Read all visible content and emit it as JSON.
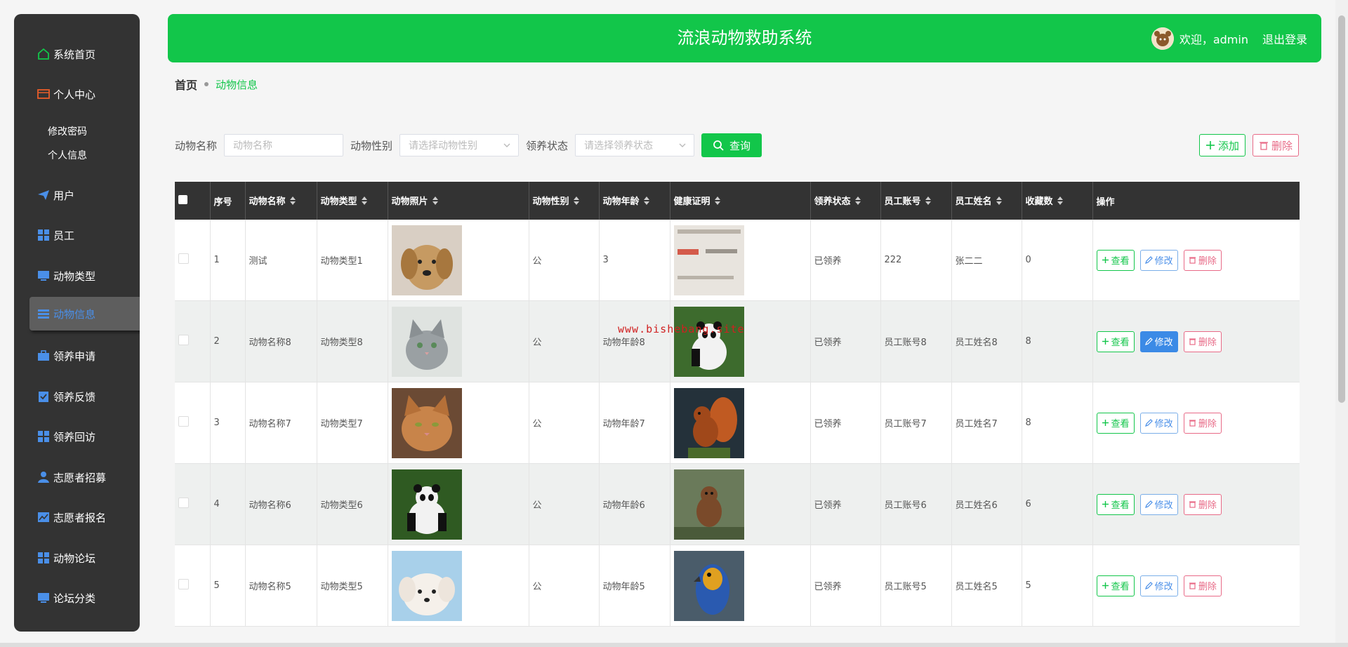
{
  "sidebar": {
    "items": [
      {
        "label": "系统首页",
        "icon": "home-icon",
        "color": "#12c64a"
      },
      {
        "label": "个人中心",
        "icon": "wallet-icon",
        "color": "#e85c2a"
      },
      {
        "label": "用户",
        "icon": "paper-plane-icon",
        "color": "#4a8fe8"
      },
      {
        "label": "员工",
        "icon": "grid-icon",
        "color": "#4a8fe8"
      },
      {
        "label": "动物类型",
        "icon": "monitor-icon",
        "color": "#4a8fe8"
      },
      {
        "label": "动物信息",
        "icon": "menu-icon",
        "color": "#4a8fe8"
      },
      {
        "label": "领养申请",
        "icon": "briefcase-icon",
        "color": "#4a8fe8"
      },
      {
        "label": "领养反馈",
        "icon": "clipboard-icon",
        "color": "#4a8fe8"
      },
      {
        "label": "领养回访",
        "icon": "grid-icon",
        "color": "#4a8fe8"
      },
      {
        "label": "志愿者招募",
        "icon": "user-icon",
        "color": "#4a8fe8"
      },
      {
        "label": "志愿者报名",
        "icon": "chart-icon",
        "color": "#4a8fe8"
      },
      {
        "label": "动物论坛",
        "icon": "grid-icon",
        "color": "#4a8fe8"
      },
      {
        "label": "论坛分类",
        "icon": "monitor-icon",
        "color": "#4a8fe8"
      }
    ],
    "sub_items": [
      "修改密码",
      "个人信息"
    ]
  },
  "header": {
    "title": "流浪动物救助系统",
    "welcome": "欢迎，admin",
    "logout": "退出登录"
  },
  "breadcrumb": {
    "home": "首页",
    "current": "动物信息"
  },
  "search": {
    "name_label": "动物名称",
    "name_placeholder": "动物名称",
    "gender_label": "动物性别",
    "gender_placeholder": "请选择动物性别",
    "status_label": "领养状态",
    "status_placeholder": "请选择领养状态",
    "search_button": "查询",
    "add_button": "添加",
    "delete_button": "删除"
  },
  "table": {
    "headers": [
      "序号",
      "动物名称",
      "动物类型",
      "动物照片",
      "动物性别",
      "动物年龄",
      "健康证明",
      "领养状态",
      "员工账号",
      "员工姓名",
      "收藏数",
      "操作"
    ],
    "rows": [
      {
        "no": "1",
        "name": "测试",
        "type": "动物类型1",
        "photo": "dog-golden",
        "gender": "公",
        "age": "3",
        "cert": "document-paper",
        "status": "已领养",
        "account": "222",
        "staff": "张二二",
        "favorites": "0"
      },
      {
        "no": "2",
        "name": "动物名称8",
        "type": "动物类型8",
        "photo": "cat-gray",
        "gender": "公",
        "age": "动物年龄8",
        "cert": "panda",
        "status": "已领养",
        "account": "员工账号8",
        "staff": "员工姓名8",
        "favorites": "8"
      },
      {
        "no": "3",
        "name": "动物名称7",
        "type": "动物类型7",
        "photo": "cat-orange",
        "gender": "公",
        "age": "动物年龄7",
        "cert": "squirrel",
        "status": "已领养",
        "account": "员工账号7",
        "staff": "员工姓名7",
        "favorites": "8"
      },
      {
        "no": "4",
        "name": "动物名称6",
        "type": "动物类型6",
        "photo": "panda",
        "gender": "公",
        "age": "动物年龄6",
        "cert": "small-monkey",
        "status": "已领养",
        "account": "员工账号6",
        "staff": "员工姓名6",
        "favorites": "6"
      },
      {
        "no": "5",
        "name": "动物名称5",
        "type": "动物类型5",
        "photo": "puppy-white",
        "gender": "公",
        "age": "动物年龄5",
        "cert": "parrot",
        "status": "已领养",
        "account": "员工账号5",
        "staff": "员工姓名5",
        "favorites": "5"
      }
    ],
    "actions": {
      "view": "查看",
      "edit": "修改",
      "delete": "删除"
    }
  },
  "watermark": "www.bishebang.site",
  "colors": {
    "primary": "#12c64a",
    "sidebar": "#333333",
    "edit": "#3b8ae6",
    "danger": "#e86a87"
  }
}
